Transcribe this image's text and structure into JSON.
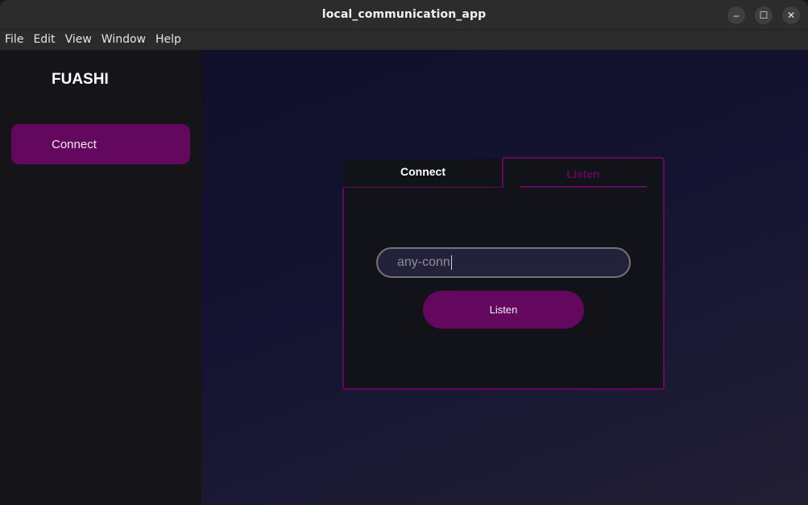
{
  "window": {
    "title": "local_communication_app",
    "controls": {
      "minimize": "–",
      "maximize": "☐",
      "close": "✕"
    }
  },
  "menubar": {
    "items": [
      "File",
      "Edit",
      "View",
      "Window",
      "Help"
    ]
  },
  "sidebar": {
    "brand": "FUASHI",
    "items": [
      {
        "label": "Connect",
        "active": true
      }
    ]
  },
  "main": {
    "tabs": [
      {
        "label": "Connect",
        "selected": false
      },
      {
        "label": "Listen",
        "selected": true
      }
    ],
    "listen_form": {
      "input_value": "any-conn",
      "button_label": "Listen"
    }
  },
  "colors": {
    "accent": "#63075f",
    "sidebar_bg": "#141419",
    "panel_bg": "#121219"
  }
}
